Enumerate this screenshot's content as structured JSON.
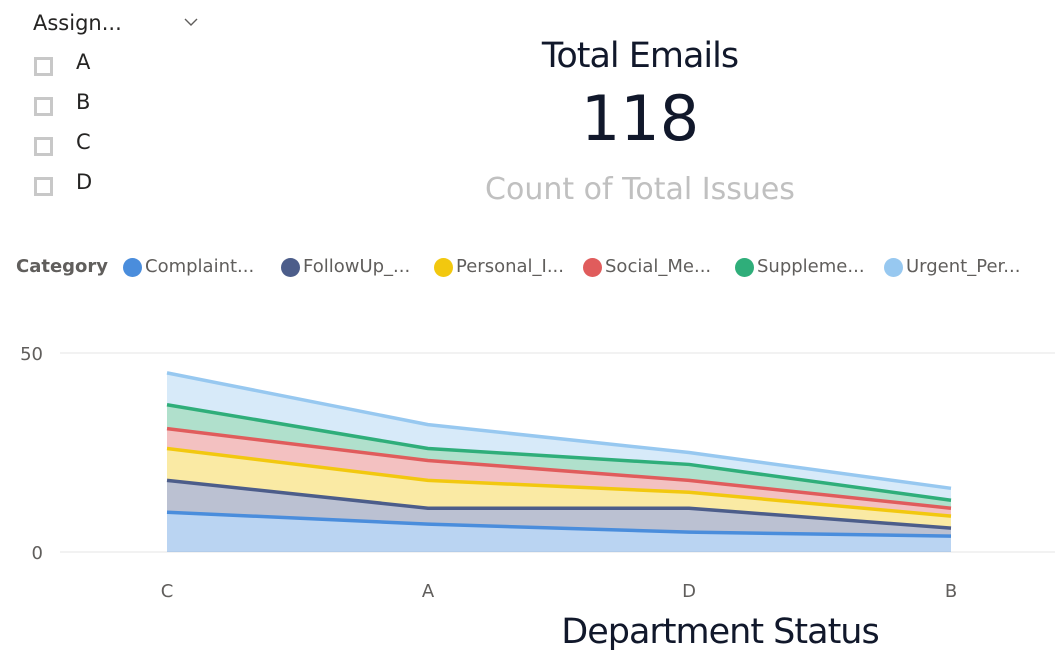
{
  "slicer": {
    "title": "Assign...",
    "items": [
      {
        "label": "A",
        "checked": false
      },
      {
        "label": "B",
        "checked": false
      },
      {
        "label": "C",
        "checked": false
      },
      {
        "label": "D",
        "checked": false
      }
    ]
  },
  "card": {
    "title": "Total Emails",
    "value": "118",
    "subtitle": "Count of Total Issues"
  },
  "legend": {
    "title": "Category",
    "items": [
      {
        "label": "Complaint...",
        "color": "#4a8ddc"
      },
      {
        "label": "FollowUp_...",
        "color": "#4c5d8a"
      },
      {
        "label": "Personal_I...",
        "color": "#f2c80f"
      },
      {
        "label": "Social_Me...",
        "color": "#e05c5c"
      },
      {
        "label": "Suppleme...",
        "color": "#2fae7a"
      },
      {
        "label": "Urgent_Per...",
        "color": "#97c8f0"
      }
    ]
  },
  "chart_data": {
    "type": "area",
    "stacked": true,
    "categories": [
      "C",
      "A",
      "D",
      "B"
    ],
    "series": [
      {
        "name": "Complaint...",
        "color": "#4a8ddc",
        "values": [
          10,
          7,
          5,
          4
        ]
      },
      {
        "name": "FollowUp_...",
        "color": "#4c5d8a",
        "values": [
          8,
          4,
          6,
          2
        ]
      },
      {
        "name": "Personal_I...",
        "color": "#f2c80f",
        "values": [
          8,
          7,
          4,
          3
        ]
      },
      {
        "name": "Social_Me...",
        "color": "#e05c5c",
        "values": [
          5,
          5,
          3,
          2
        ]
      },
      {
        "name": "Suppleme...",
        "color": "#2fae7a",
        "values": [
          6,
          3,
          4,
          2
        ]
      },
      {
        "name": "Urgent_Per...",
        "color": "#97c8f0",
        "values": [
          8,
          6,
          3,
          3
        ]
      }
    ],
    "y_ticks": [
      "0",
      "50"
    ],
    "ylim": [
      0,
      50
    ],
    "xlabel": "Department Status",
    "grid": true,
    "legend_position": "top"
  }
}
